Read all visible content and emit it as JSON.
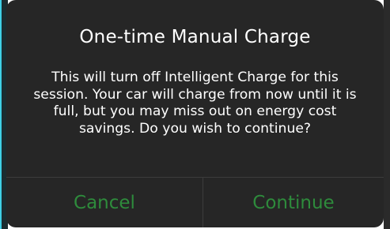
{
  "dialog": {
    "title": "One-time Manual Charge",
    "message": "This will turn off Intelligent Charge for this session. Your car will charge from now until it is full, but you may miss out on energy cost savings. Do you wish to continue?",
    "cancel_label": "Cancel",
    "continue_label": "Continue"
  },
  "colors": {
    "dialog_background": "#262626",
    "button_text": "#2e8b3c",
    "text": "#ffffff"
  }
}
